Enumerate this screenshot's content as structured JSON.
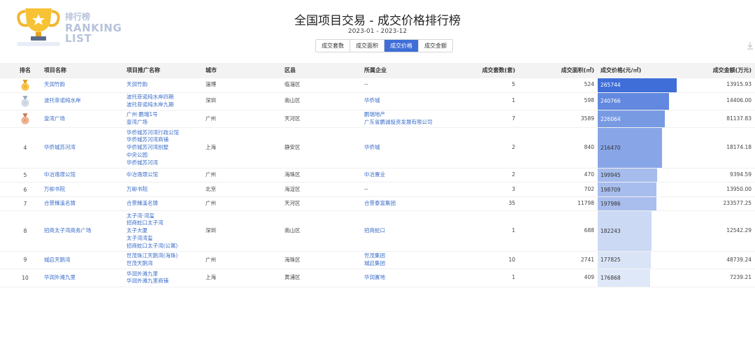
{
  "logo": {
    "cn": "排行榜",
    "en_line1": "RANKING",
    "en_line2": "LIST"
  },
  "title": "全国项目交易 - 成交价格排行榜",
  "date_range": "2023-01 - 2023-12",
  "tabs": [
    {
      "label": "成交套数",
      "active": false
    },
    {
      "label": "成交面积",
      "active": false
    },
    {
      "label": "成交价格",
      "active": true
    },
    {
      "label": "成交金额",
      "active": false
    }
  ],
  "columns": {
    "rank": "排名",
    "project": "项目名称",
    "promo": "项目推广名称",
    "city": "城市",
    "district": "区县",
    "company": "所属企业",
    "units": "成交套数(套)",
    "area": "成交面积(㎡)",
    "price": "成交价格(元/㎡)",
    "amount": "成交金额(万元)"
  },
  "price_max": 265744,
  "colors": {
    "accent": "#3f6ed8",
    "bar_dark": "#3f6ed8",
    "bar_light": "#dfe8f8",
    "link": "#3a6dc9"
  },
  "rows": [
    {
      "rank": "1",
      "medal": "gold",
      "project": "天润竹韵",
      "promo": [
        "天润竹韵"
      ],
      "city": "淄博",
      "district": "临淄区",
      "company": [
        "--"
      ],
      "units": "5",
      "area": "524",
      "price": 265744,
      "amount": "13915.93"
    },
    {
      "rank": "2",
      "medal": "silver",
      "project": "波托菲诺纯水岸",
      "promo": [
        "波托菲诺纯水岸四期",
        "波托菲诺纯水岸九期"
      ],
      "city": "深圳",
      "district": "南山区",
      "company": [
        "华侨城"
      ],
      "units": "1",
      "area": "598",
      "price": 240766,
      "amount": "14406.00"
    },
    {
      "rank": "3",
      "medal": "bronze",
      "project": "壹湾广场",
      "promo": [
        "广州·鹏瑞1号",
        "壹湾广场"
      ],
      "city": "广州",
      "district": "天河区",
      "company": [
        "鹏瑞地产",
        "广东省鹏诚投资发展有限公司"
      ],
      "units": "7",
      "area": "3589",
      "price": 226064,
      "amount": "81137.83"
    },
    {
      "rank": "4",
      "medal": "",
      "project": "华侨城苏河湾",
      "promo": [
        "华侨城苏河湾行政公馆",
        "华侨城苏河湾商铺",
        "华侨城苏河湾别墅",
        "中央公园",
        "华侨城苏河湾"
      ],
      "city": "上海",
      "district": "静安区",
      "company": [
        "华侨城"
      ],
      "units": "2",
      "area": "840",
      "price": 216470,
      "amount": "18174.18"
    },
    {
      "rank": "5",
      "medal": "",
      "project": "中冶逸璟公馆",
      "promo": [
        "中冶逸璟公馆"
      ],
      "city": "广州",
      "district": "海珠区",
      "company": [
        "中冶置业"
      ],
      "units": "2",
      "area": "470",
      "price": 199945,
      "amount": "9394.59"
    },
    {
      "rank": "6",
      "medal": "",
      "project": "万柳书院",
      "promo": [
        "万柳书院"
      ],
      "city": "北京",
      "district": "海淀区",
      "company": [
        "--"
      ],
      "units": "3",
      "area": "702",
      "price": 198709,
      "amount": "13950.00"
    },
    {
      "rank": "7",
      "medal": "",
      "project": "合景臻溪名铸",
      "promo": [
        "合景臻溪名铸"
      ],
      "city": "广州",
      "district": "天河区",
      "company": [
        "合景泰富集团"
      ],
      "units": "35",
      "area": "11798",
      "price": 197986,
      "amount": "233577.25"
    },
    {
      "rank": "8",
      "medal": "",
      "project": "招商太子湾商务广场",
      "promo": [
        "太子湾·湾玺",
        "招商蛇口太子湾",
        "太子大厦",
        "太子湾湾玺",
        "招商蛇口太子湾(公寓)"
      ],
      "city": "深圳",
      "district": "南山区",
      "company": [
        "招商蛇口"
      ],
      "units": "1",
      "area": "688",
      "price": 182243,
      "amount": "12542.29"
    },
    {
      "rank": "9",
      "medal": "",
      "project": "城启天鹅湾",
      "promo": [
        "世茂珠江天鹅湾(海珠)",
        "世茂天鹅湾"
      ],
      "city": "广州",
      "district": "海珠区",
      "company": [
        "世茂集团",
        "城启集团"
      ],
      "units": "10",
      "area": "2741",
      "price": 177825,
      "amount": "48739.24"
    },
    {
      "rank": "10",
      "medal": "",
      "project": "华润外滩九里",
      "promo": [
        "华润外滩九里",
        "华润外滩九里商铺"
      ],
      "city": "上海",
      "district": "黄浦区",
      "company": [
        "华润置地"
      ],
      "units": "1",
      "area": "409",
      "price": 176868,
      "amount": "7239.21"
    }
  ]
}
